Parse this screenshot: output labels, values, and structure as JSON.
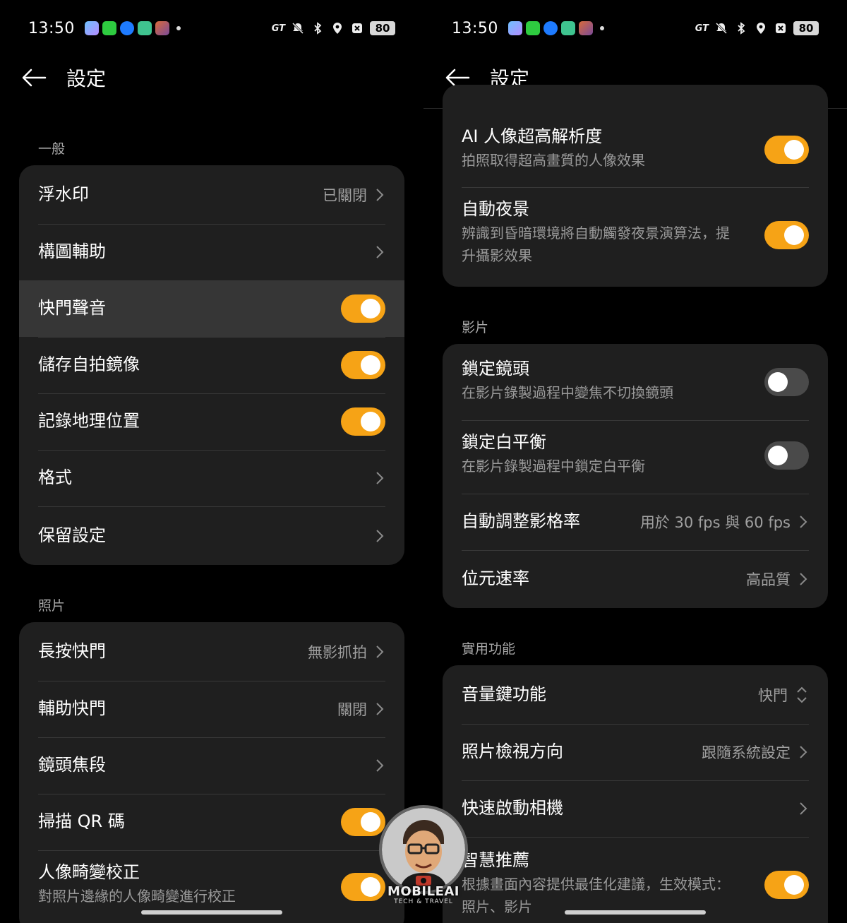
{
  "status_bar": {
    "time": "13:50",
    "gt_badge": "GT",
    "battery": "80",
    "notification_icons": [
      "photos-icon",
      "store-icon",
      "gt-icon",
      "download-icon",
      "game-icon"
    ],
    "system_icons": [
      "mute-icon",
      "bluetooth-icon",
      "location-icon",
      "box-icon",
      "battery-icon"
    ]
  },
  "left": {
    "header": {
      "title": "設定"
    },
    "sections": {
      "general": {
        "label": "一般",
        "items": [
          {
            "label": "浮水印",
            "value": "已關閉",
            "control": "chevron"
          },
          {
            "label": "構圖輔助",
            "value": "",
            "control": "chevron"
          },
          {
            "label": "快門聲音",
            "control": "toggle",
            "state": "on",
            "highlighted": true
          },
          {
            "label": "儲存自拍鏡像",
            "control": "toggle",
            "state": "on"
          },
          {
            "label": "記錄地理位置",
            "control": "toggle",
            "state": "on"
          },
          {
            "label": "格式",
            "value": "",
            "control": "chevron"
          },
          {
            "label": "保留設定",
            "value": "",
            "control": "chevron"
          }
        ]
      },
      "photo": {
        "label": "照片",
        "items": [
          {
            "label": "長按快門",
            "value": "無影抓拍",
            "control": "chevron"
          },
          {
            "label": "輔助快門",
            "value": "關閉",
            "control": "chevron"
          },
          {
            "label": "鏡頭焦段",
            "value": "",
            "control": "chevron"
          },
          {
            "label": "掃描 QR 碼",
            "control": "toggle",
            "state": "on"
          },
          {
            "label": "人像畸變校正",
            "sub": "對照片邊緣的人像畸變進行校正",
            "control": "toggle",
            "state": "on"
          }
        ]
      }
    }
  },
  "right": {
    "header": {
      "title": "設定"
    },
    "sections": {
      "photo_cont": {
        "items": [
          {
            "label": "AI 人像超高解析度",
            "sub": "拍照取得超高畫質的人像效果",
            "control": "toggle",
            "state": "on"
          },
          {
            "label": "自動夜景",
            "sub": "辨識到昏暗環境將自動觸發夜景演算法，提升攝影效果",
            "control": "toggle",
            "state": "on"
          }
        ]
      },
      "video": {
        "label": "影片",
        "items": [
          {
            "label": "鎖定鏡頭",
            "sub": "在影片錄製過程中變焦不切換鏡頭",
            "control": "toggle",
            "state": "off"
          },
          {
            "label": "鎖定白平衡",
            "sub": "在影片錄製過程中鎖定白平衡",
            "control": "toggle",
            "state": "off"
          },
          {
            "label": "自動調整影格率",
            "value": "用於 30 fps 與 60 fps",
            "control": "chevron"
          },
          {
            "label": "位元速率",
            "value": "高品質",
            "control": "chevron"
          }
        ]
      },
      "utility": {
        "label": "實用功能",
        "items": [
          {
            "label": "音量鍵功能",
            "value": "快門",
            "control": "updown"
          },
          {
            "label": "照片檢視方向",
            "value": "跟隨系統設定",
            "control": "chevron"
          },
          {
            "label": "快速啟動相機",
            "value": "",
            "control": "chevron"
          },
          {
            "label": "智慧推薦",
            "sub": "根據畫面內容提供最佳化建議，生效模式：照片、影片",
            "control": "toggle",
            "state": "on"
          }
        ]
      }
    }
  },
  "watermark": {
    "text": "MOBILEAI",
    "sub": "TECH & TRAVEL"
  },
  "colors": {
    "accent": "#f6a316",
    "card": "#1f1f1f",
    "highlight": "#363636",
    "background": "#000000"
  }
}
